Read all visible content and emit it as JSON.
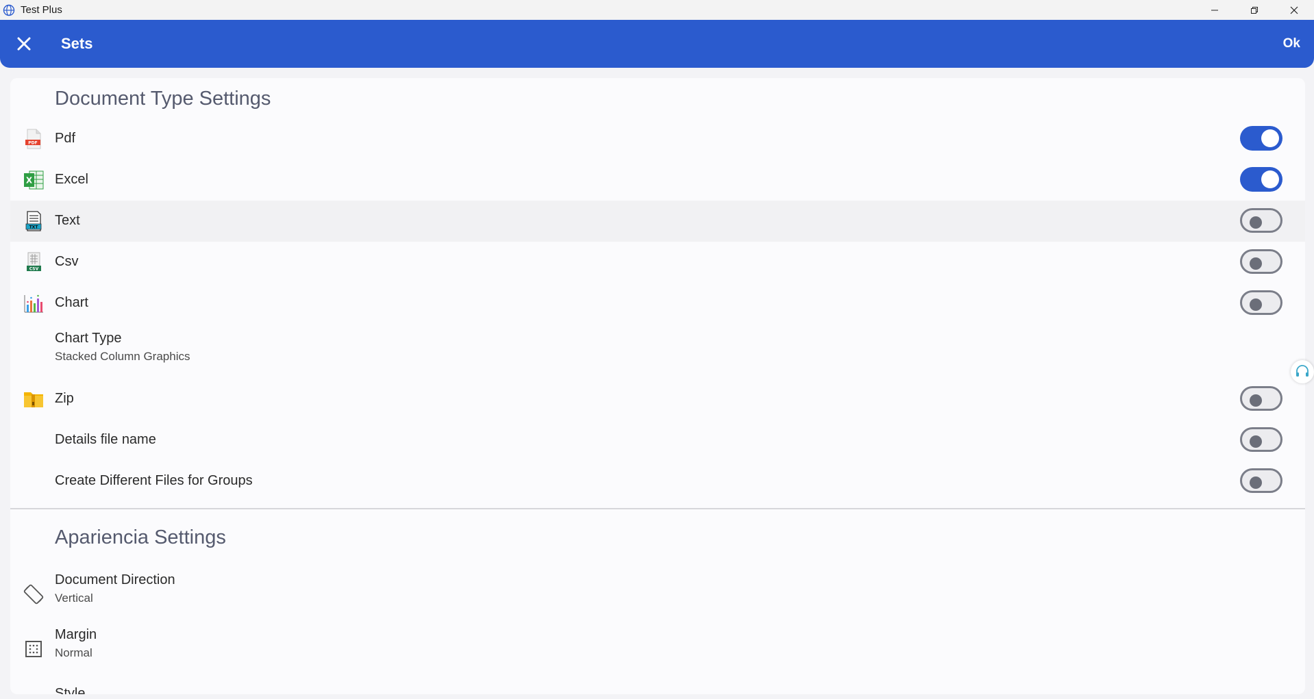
{
  "window": {
    "title": "Test Plus"
  },
  "header": {
    "title": "Sets",
    "ok_label": "Ok"
  },
  "sections": {
    "document_type": {
      "title": "Document Type Settings",
      "rows": {
        "pdf": {
          "label": "Pdf",
          "enabled": true,
          "icon": "pdf-file-icon"
        },
        "excel": {
          "label": "Excel",
          "enabled": true,
          "icon": "excel-file-icon"
        },
        "text": {
          "label": "Text",
          "enabled": false,
          "icon": "text-file-icon"
        },
        "csv": {
          "label": "Csv",
          "enabled": false,
          "icon": "csv-file-icon"
        },
        "chart": {
          "label": "Chart",
          "enabled": false,
          "icon": "bar-chart-icon"
        },
        "chart_type": {
          "label": "Chart Type",
          "value": "Stacked Column Graphics"
        },
        "zip": {
          "label": "Zip",
          "enabled": false,
          "icon": "zip-folder-icon"
        },
        "details_file_name": {
          "label": "Details file name",
          "enabled": false
        },
        "different_files": {
          "label": "Create Different Files for Groups",
          "enabled": false
        }
      }
    },
    "appearance": {
      "title": "Apariencia Settings",
      "rows": {
        "direction": {
          "label": "Document Direction",
          "value": "Vertical",
          "icon": "rotate-screen-icon"
        },
        "margin": {
          "label": "Margin",
          "value": "Normal",
          "icon": "margin-grid-icon"
        },
        "style": {
          "label": "Style",
          "icon": "style-icon"
        }
      }
    }
  },
  "colors": {
    "accent": "#2b5bce",
    "toggle_off_border": "#7b7e89"
  }
}
